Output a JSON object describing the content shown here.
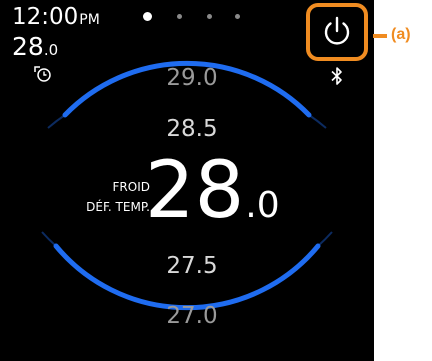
{
  "status": {
    "time": "12:00",
    "ampm": "PM",
    "current_temp_whole": "28",
    "current_temp_decimal": ".0"
  },
  "page_dots": {
    "count": 4,
    "active_index": 0
  },
  "power": {
    "icon": "power-icon",
    "state": "on"
  },
  "bluetooth": {
    "icon": "bluetooth-icon"
  },
  "mode": {
    "line1": "FROID",
    "line2": "DÉF. TEMP."
  },
  "setpoint": {
    "whole": "28",
    "decimal": ".0"
  },
  "selector": {
    "above": [
      "29.0",
      "28.5"
    ],
    "below": [
      "27.5",
      "27.0"
    ]
  },
  "annotation": {
    "label": "(a)"
  },
  "colors": {
    "accent": "#1f6cf0",
    "callout": "#f08c21",
    "background": "#000000",
    "text": "#ffffff"
  }
}
